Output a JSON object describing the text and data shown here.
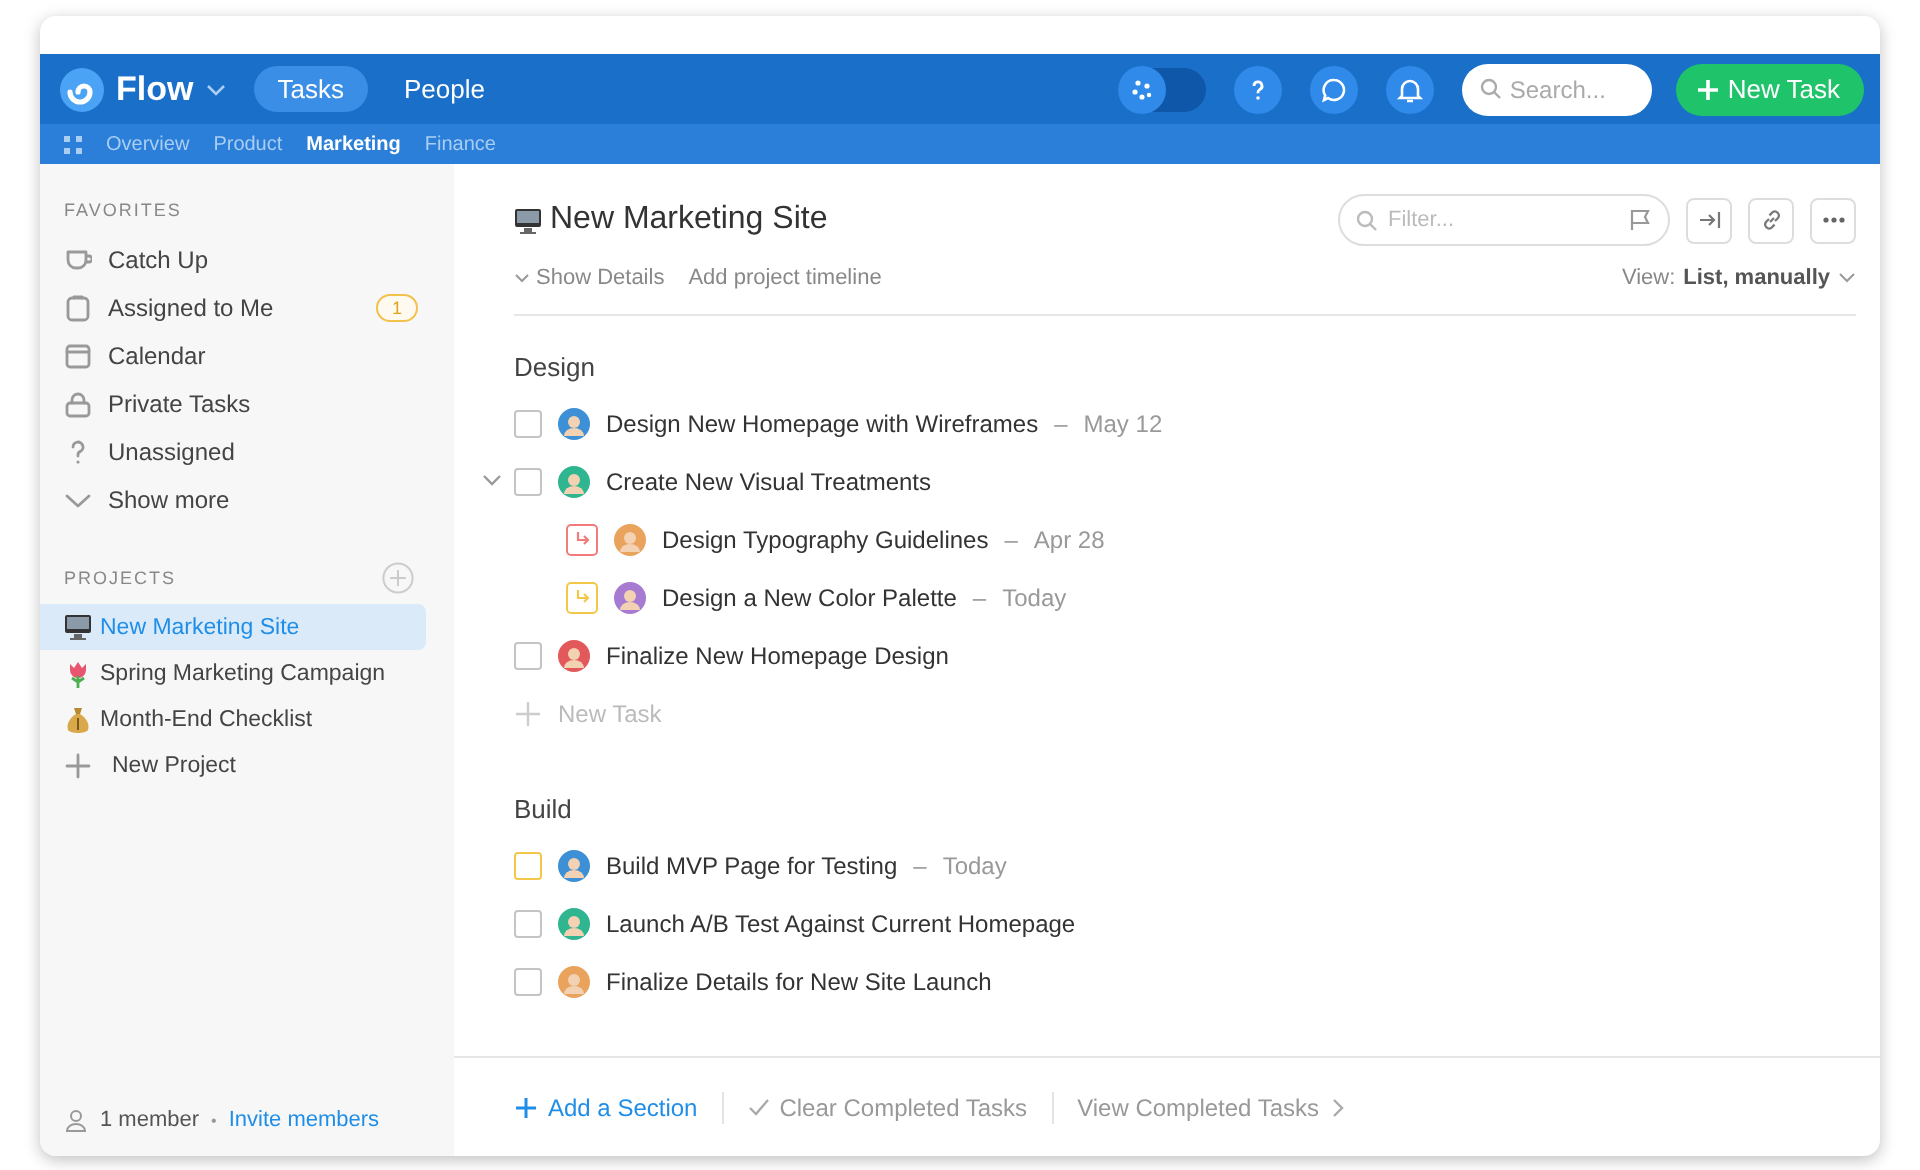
{
  "topbar": {
    "brand": "Flow",
    "tabs": [
      {
        "label": "Tasks",
        "selected": true
      },
      {
        "label": "People",
        "selected": false
      }
    ],
    "toggle": {
      "on": false
    },
    "search": {
      "placeholder": "Search..."
    },
    "new_task_button": "New Task"
  },
  "subnav": [
    {
      "label": "Overview",
      "selected": false
    },
    {
      "label": "Product",
      "selected": false
    },
    {
      "label": "Marketing",
      "selected": true
    },
    {
      "label": "Finance",
      "selected": false
    }
  ],
  "sidebar": {
    "favorites_heading": "FAVORITES",
    "favorites": [
      {
        "kind": "cup",
        "label": "Catch Up"
      },
      {
        "kind": "clipboard",
        "label": "Assigned to Me",
        "badge": "1"
      },
      {
        "kind": "calendar",
        "label": "Calendar"
      },
      {
        "kind": "lock",
        "label": "Private Tasks"
      },
      {
        "kind": "question",
        "label": "Unassigned"
      },
      {
        "kind": "chevron",
        "label": "Show more"
      }
    ],
    "projects_heading": "PROJECTS",
    "projects": [
      {
        "kind": "monitor",
        "label": "New Marketing Site",
        "selected": true
      },
      {
        "kind": "tulip",
        "label": "Spring Marketing Campaign",
        "selected": false
      },
      {
        "kind": "moneybag",
        "label": "Month-End Checklist",
        "selected": false
      },
      {
        "kind": "plus",
        "label": "New Project",
        "selected": false
      }
    ],
    "footer": {
      "members": "1 member",
      "separator": "•",
      "invite_link": "Invite members"
    }
  },
  "project": {
    "title": "New Marketing Site",
    "show_details": "Show Details",
    "timeline_link": "Add project timeline",
    "filter": {
      "placeholder": "Filter..."
    },
    "view_label": "View:",
    "view_value": "List, manually",
    "sections": [
      {
        "name": "Design",
        "tasks": [
          {
            "kind": "task",
            "box": {
              "checked": false,
              "color": "#c4c4c4"
            },
            "title": "Design New Homepage with Wireframes",
            "dash": "–",
            "due": "May 12",
            "color": "#3d8fd6"
          },
          {
            "kind": "task",
            "box": {
              "checked": false,
              "color": "#c4c4c4"
            },
            "title": "Create New Visual Treatments",
            "expanded": true,
            "color": "#2fb58f",
            "children": [
              {
                "kind": "subtask",
                "box": {
                  "color": "#f07c7c"
                },
                "title": "Design Typography Guidelines",
                "dash": "–",
                "due": "Apr 28",
                "color": "#e9a35d"
              },
              {
                "kind": "subtask",
                "box": {
                  "color": "#f3c84a"
                },
                "title": "Design a New Color Palette",
                "dash": "–",
                "due": "Today",
                "color": "#a67bd1"
              }
            ]
          },
          {
            "kind": "task",
            "box": {
              "checked": false,
              "color": "#c4c4c4"
            },
            "title": "Finalize New Homepage Design",
            "color": "#e2585b"
          }
        ],
        "new_task": "New Task"
      },
      {
        "name": "Build",
        "tasks": [
          {
            "kind": "task",
            "box": {
              "checked": false,
              "color": "#f3c84a"
            },
            "title": "Build MVP Page for Testing",
            "dash": "–",
            "due": "Today",
            "color": "#3d8fd6"
          },
          {
            "kind": "task",
            "box": {
              "checked": false,
              "color": "#c4c4c4"
            },
            "title": "Launch A/B Test Against Current Homepage",
            "color": "#2fb58f"
          },
          {
            "kind": "task",
            "box": {
              "checked": false,
              "color": "#c4c4c4"
            },
            "title": "Finalize Details for New Site Launch",
            "color": "#e9a35d"
          }
        ]
      }
    ],
    "footer": {
      "add_section": "Add a Section",
      "clear_completed": "Clear Completed Tasks",
      "view_completed": "View Completed Tasks"
    }
  }
}
